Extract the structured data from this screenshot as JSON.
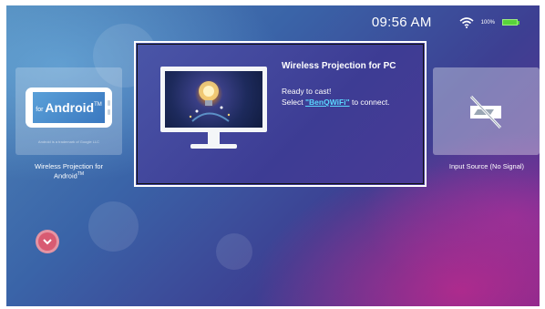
{
  "status": {
    "time": "09:56 AM",
    "battery_percent": "100%",
    "wifi_icon": "wifi-icon",
    "battery_icon": "battery-icon"
  },
  "tiles": [
    {
      "id": "android",
      "icon": "android-phone-icon",
      "graphic_text_for": "for",
      "graphic_text_main": "Android",
      "graphic_text_tm": "TM",
      "trademark_note": "Android is a trademark of Google LLC",
      "label_line1": "Wireless Projection for",
      "label_line2": "Android",
      "label_tm": "TM"
    },
    {
      "id": "pc",
      "icon": "monitor-icon",
      "title": "Wireless Projection for PC",
      "ready_text": "Ready to cast!",
      "select_prefix": "Select ",
      "ssid": "\"BenQWiFi\"",
      "select_suffix": " to connect."
    },
    {
      "id": "input",
      "icon": "no-signal-icon",
      "label": "Input Source (No Signal)"
    }
  ],
  "nav": {
    "down_icon": "chevron-down-icon"
  },
  "colors": {
    "accent_link": "#5ad8ff",
    "battery": "#58d23a",
    "down_button": "#d85b72"
  }
}
